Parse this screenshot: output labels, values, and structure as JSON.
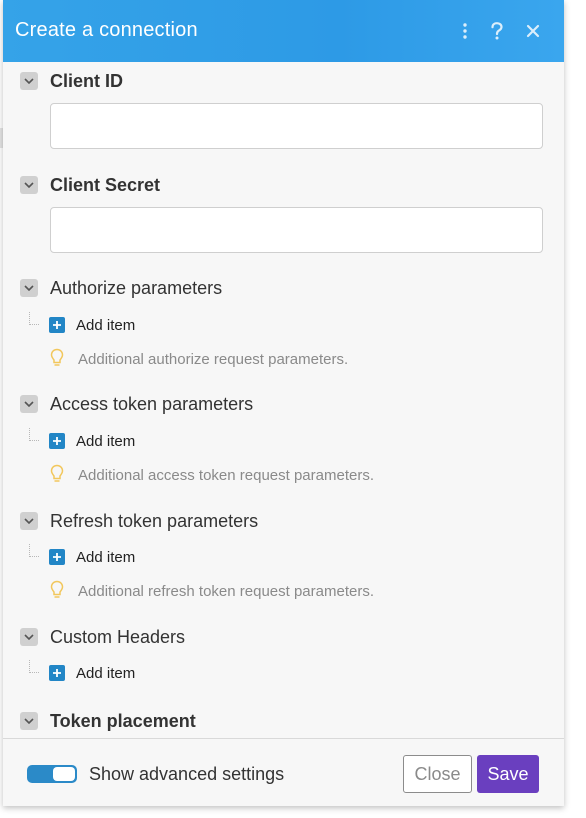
{
  "dialog": {
    "title": "Create a connection",
    "header_icons": [
      "kebab-menu-icon",
      "help-icon",
      "close-icon"
    ]
  },
  "fields": [
    {
      "label": "Client ID",
      "value": ""
    },
    {
      "label": "Client Secret",
      "value": ""
    }
  ],
  "parameter_groups": [
    {
      "label": "Authorize parameters",
      "add_label": "Add item",
      "hint": "Additional authorize request parameters."
    },
    {
      "label": "Access token parameters",
      "add_label": "Add item",
      "hint": "Additional access token request parameters."
    },
    {
      "label": "Refresh token parameters",
      "add_label": "Add item",
      "hint": "Additional refresh token request parameters."
    },
    {
      "label": "Custom Headers",
      "add_label": "Add item"
    }
  ],
  "token_placement": {
    "label": "Token placement"
  },
  "footer": {
    "toggle_label": "Show advanced settings",
    "toggle_on": true,
    "close_label": "Close",
    "save_label": "Save"
  },
  "colors": {
    "header": "#2d9ae6",
    "accent_blue": "#2286c6",
    "save": "#6a3fbf",
    "hint_bulb": "#f2c75c"
  }
}
